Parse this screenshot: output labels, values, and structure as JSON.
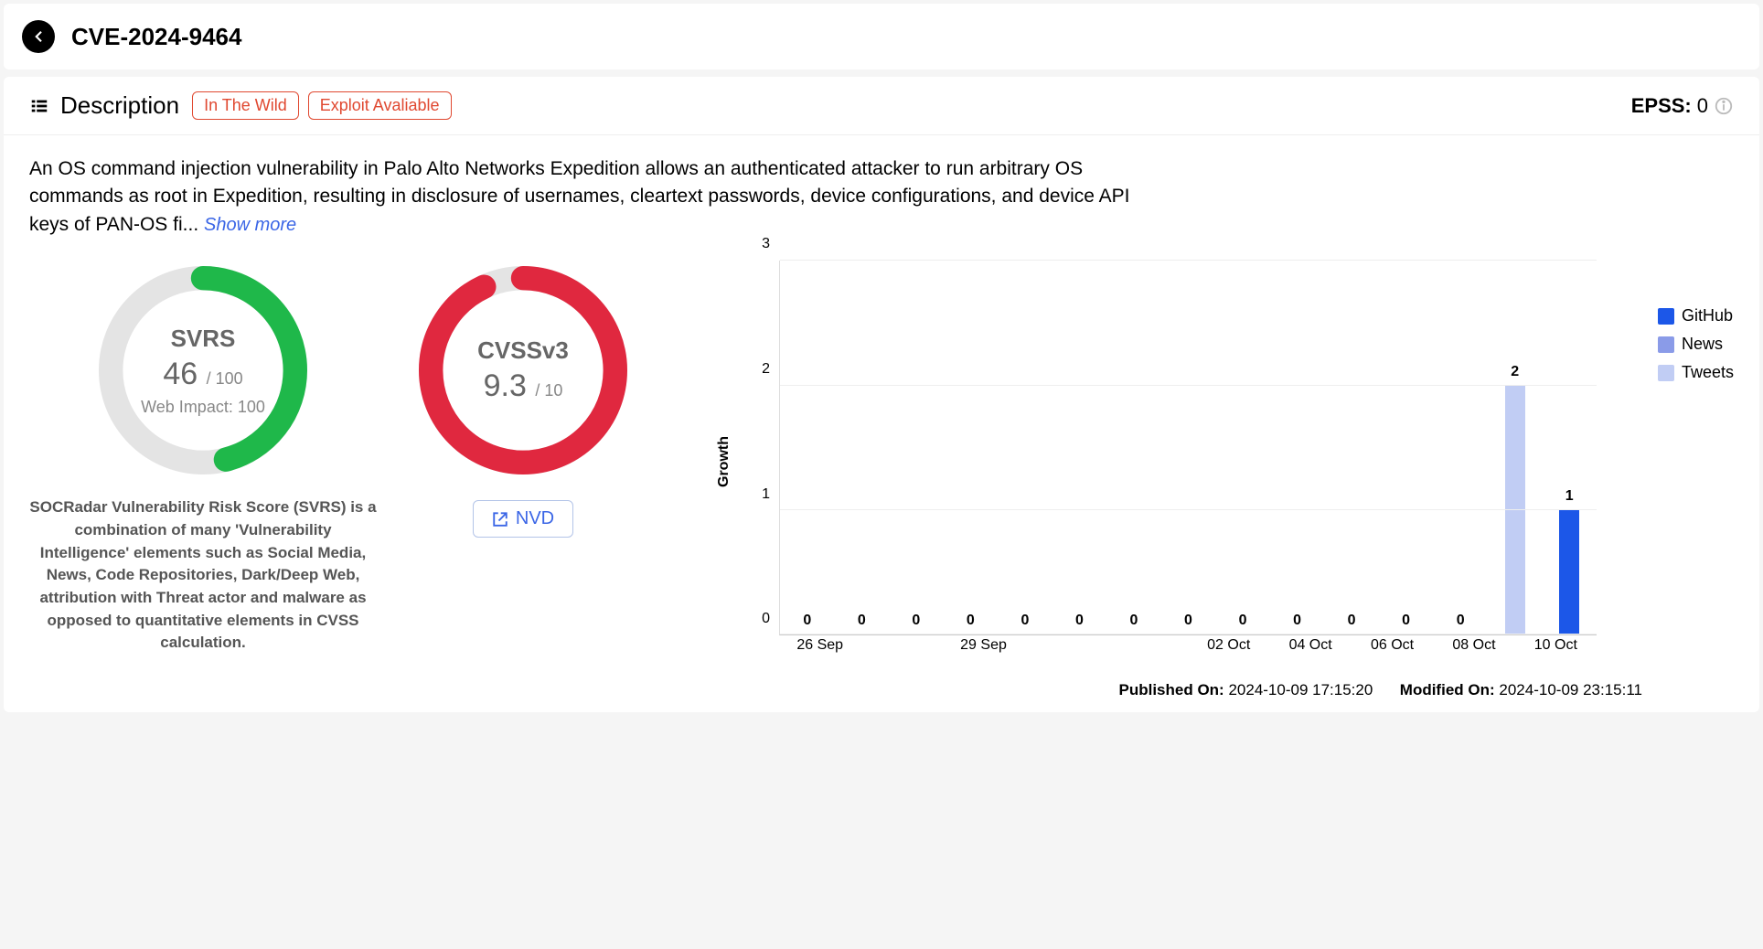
{
  "header": {
    "title": "CVE-2024-9464"
  },
  "section": {
    "title": "Description",
    "badges": [
      "In The Wild",
      "Exploit Avaliable"
    ],
    "epss_label": "EPSS:",
    "epss_value": "0"
  },
  "description": {
    "text": "An OS command injection vulnerability in Palo Alto Networks Expedition allows an authenticated attacker to run arbitrary OS commands as root in Expedition, resulting in disclosure of usernames, cleartext passwords, device configurations, and device API keys of PAN-OS fi...",
    "show_more": "Show more"
  },
  "gauges": {
    "svrs": {
      "label": "SVRS",
      "value": "46",
      "max": "/ 100",
      "sub": "Web Impact: 100",
      "pct": 46,
      "color": "#1fb84a"
    },
    "cvss": {
      "label": "CVSSv3",
      "value": "9.3",
      "max": "/ 10",
      "pct": 93,
      "color": "#e0283f"
    },
    "desc": "SOCRadar Vulnerability Risk Score (SVRS) is a combination of many 'Vulnerability Intelligence' elements such as Social Media, News, Code Repositories, Dark/Deep Web, attribution with Threat actor and malware as opposed to quantitative elements in CVSS calculation.",
    "nvd_label": "NVD"
  },
  "chart_data": {
    "type": "bar",
    "ylabel": "Growth",
    "ylim": [
      0,
      3
    ],
    "yticks": [
      0,
      1,
      2,
      3
    ],
    "categories": [
      "26 Sep",
      "",
      "29 Sep",
      "",
      "",
      "02 Oct",
      "04 Oct",
      "06 Oct",
      "08 Oct",
      "10 Oct"
    ],
    "series": [
      {
        "name": "GitHub",
        "color": "#1c57e8",
        "values": [
          0,
          0,
          0,
          0,
          0,
          0,
          0,
          0,
          0,
          0,
          0,
          0,
          0,
          null,
          1
        ]
      },
      {
        "name": "News",
        "color": "#8a9be8",
        "values": [
          0,
          0,
          0,
          0,
          0,
          0,
          0,
          0,
          0,
          0,
          0,
          0,
          0,
          null,
          null
        ]
      },
      {
        "name": "Tweets",
        "color": "#c1cdf4",
        "values": [
          0,
          0,
          0,
          0,
          0,
          0,
          0,
          0,
          0,
          0,
          0,
          0,
          0,
          2,
          null
        ]
      }
    ],
    "labels_above": [
      0,
      0,
      0,
      0,
      0,
      0,
      0,
      0,
      0,
      0,
      0,
      0,
      0,
      2,
      1
    ]
  },
  "meta": {
    "published_label": "Published On:",
    "published_value": "2024-10-09 17:15:20",
    "modified_label": "Modified On:",
    "modified_value": "2024-10-09 23:15:11"
  }
}
